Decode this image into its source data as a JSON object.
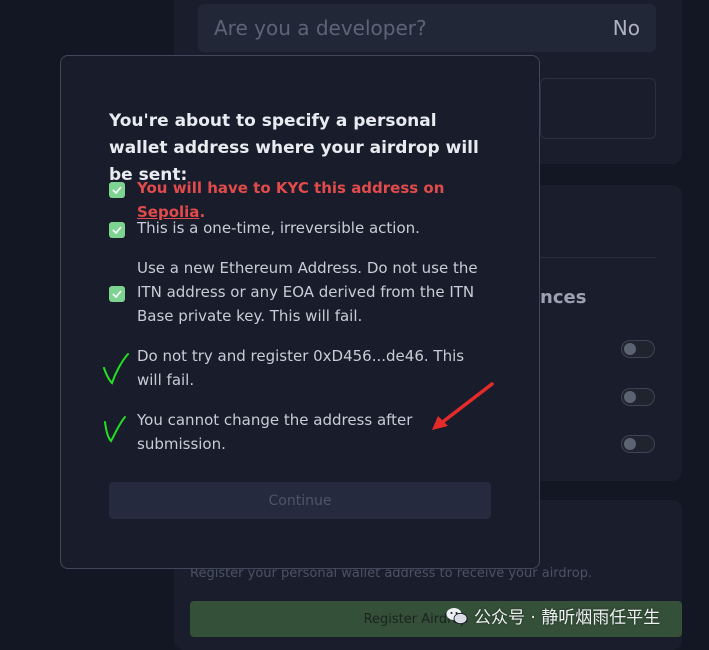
{
  "background": {
    "developer_question": "Are you a developer?",
    "developer_answer": "No",
    "section_heading": "nces",
    "register_description": "Register your personal wallet address to receive your airdrop.",
    "register_button": "Register Airdrop"
  },
  "modal": {
    "title": "You're about to specify a personal wallet address where your airdrop will be sent:",
    "items": [
      {
        "text": "You will have to KYC this address on ",
        "link": "Sepolia",
        "after": "."
      },
      {
        "text": "This is a one-time, irreversible action."
      },
      {
        "text": "Use a new Ethereum Address. Do not use the ITN address or any EOA derived from the ITN Base private key. This will fail."
      },
      {
        "text": "Do not try and register 0xD456...de46. This will fail."
      },
      {
        "text": "You cannot change the address after submission."
      }
    ],
    "continue_label": "Continue"
  },
  "watermark": {
    "text": "公众号 · 静听烟雨任平生"
  },
  "colors": {
    "warning": "#e14b4b",
    "check": "#7ed391",
    "annotation_check": "#22e022",
    "annotation_arrow": "#e52a2a"
  }
}
